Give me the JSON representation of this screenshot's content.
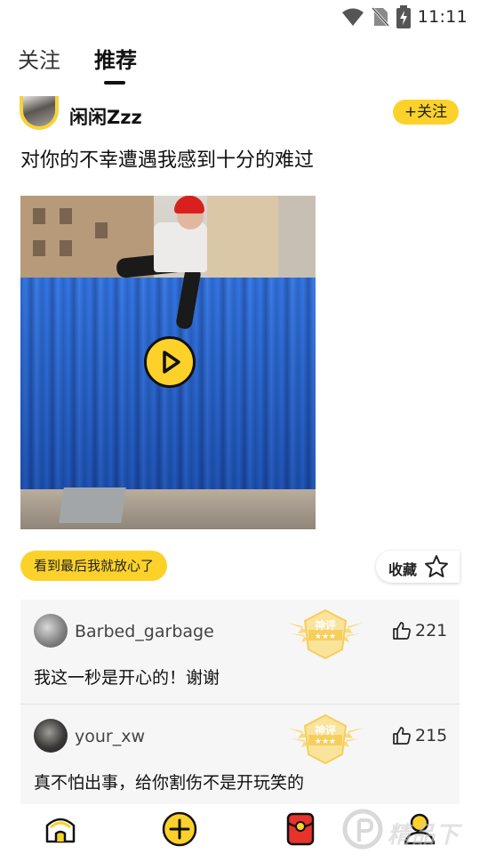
{
  "status_bar": {
    "time": "11:11",
    "icons": [
      "wifi-icon",
      "no-sim-icon",
      "battery-charging-icon"
    ]
  },
  "tabs": [
    {
      "label": "关注",
      "active": false
    },
    {
      "label": "推荐",
      "active": true
    }
  ],
  "post": {
    "author": "闲闲Zzz",
    "follow_label": "+关注",
    "text": "对你的不幸遭遇我感到十分的难过",
    "tag": "看到最后我就放心了",
    "favorite_label": "收藏"
  },
  "comments": [
    {
      "user": "Barbed_garbage",
      "likes": "221",
      "text": "我这一秒是开心的！谢谢",
      "badge": "神评"
    },
    {
      "user": "your_xw",
      "likes": "215",
      "text": "真不怕出事，给你割伤不是开玩笑的",
      "badge": "神评"
    }
  ],
  "bottom_nav": [
    "home-icon",
    "add-icon",
    "red-packet-icon",
    "profile-icon"
  ],
  "watermark": "精品下载",
  "colors": {
    "accent": "#fcd22a",
    "fence_blue": "#2c6fe0",
    "text": "#111111"
  }
}
